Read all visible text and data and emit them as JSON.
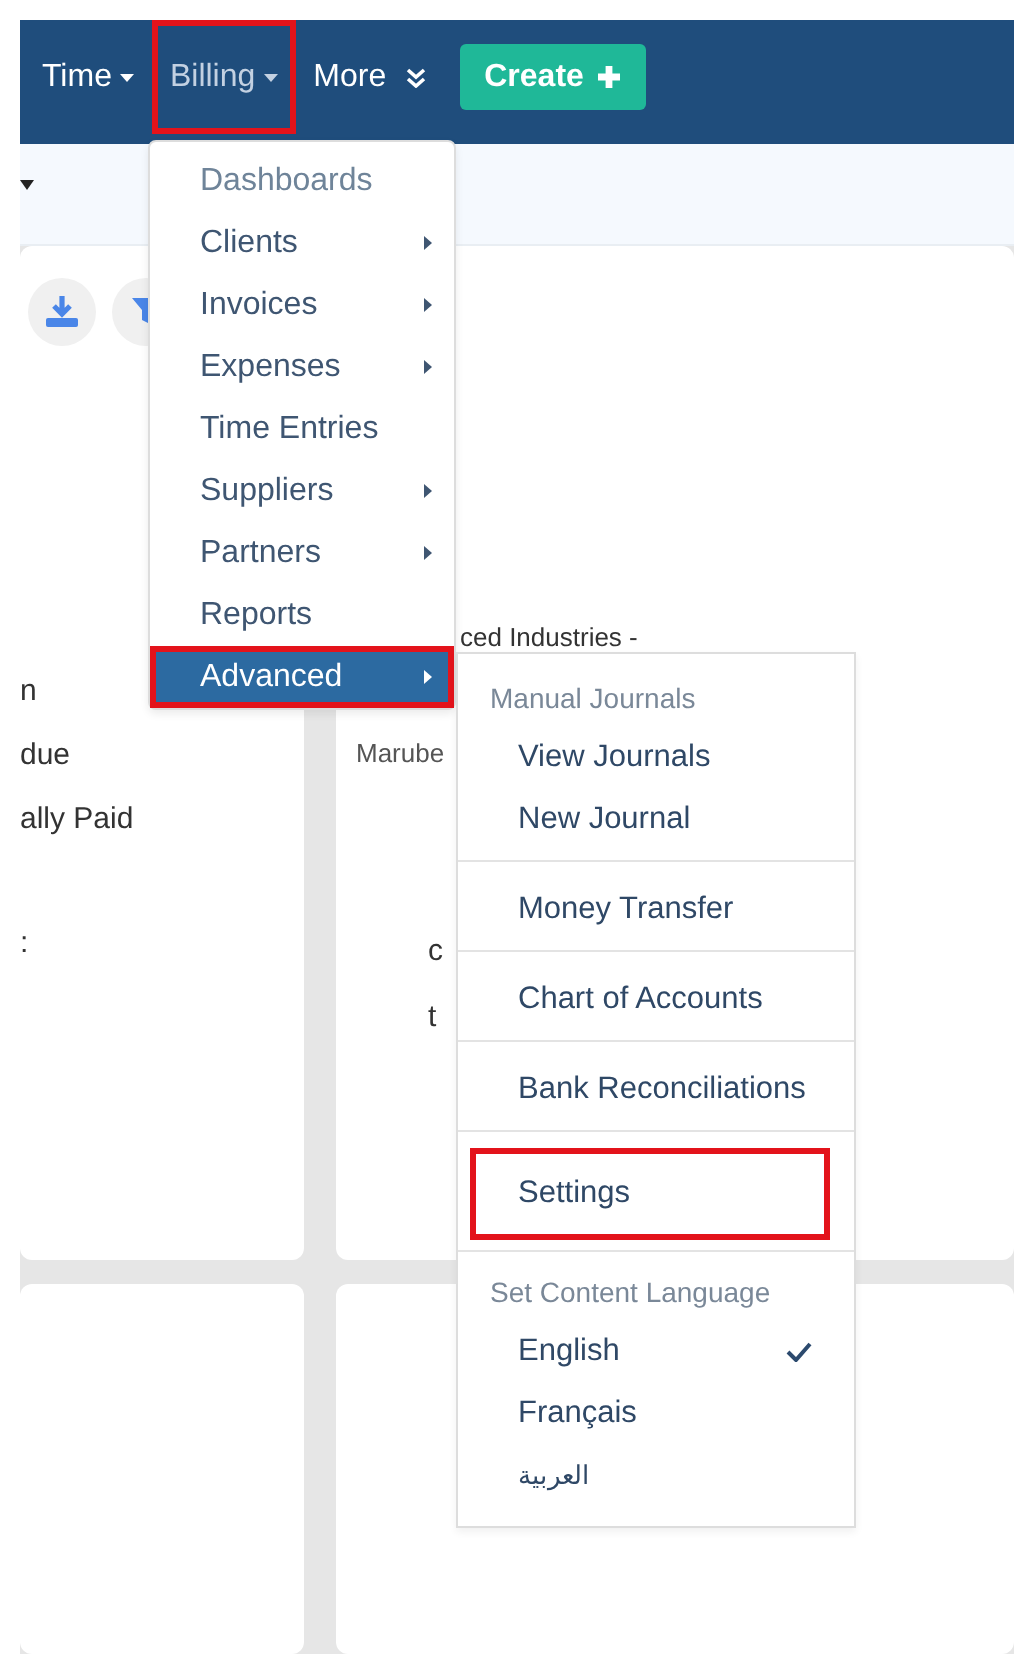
{
  "nav": {
    "items": [
      {
        "label": "Time",
        "kind": "dropdown",
        "selected": false,
        "highlighted": false
      },
      {
        "label": "Billing",
        "kind": "dropdown",
        "selected": true,
        "highlighted": true
      },
      {
        "label": "More",
        "kind": "more",
        "selected": false,
        "highlighted": false
      }
    ],
    "create_button": {
      "label": "Create"
    }
  },
  "page": {
    "left_texts": [
      "n",
      "due",
      "ally Paid",
      ":"
    ],
    "right_texts": [
      "ced Industries -",
      "Marube",
      "c",
      "t"
    ]
  },
  "billing_menu": [
    {
      "label": "Dashboards",
      "kind": "muted",
      "submenu": false,
      "selected": false,
      "highlighted": false
    },
    {
      "label": "Clients",
      "kind": "item",
      "submenu": true,
      "selected": false,
      "highlighted": false
    },
    {
      "label": "Invoices",
      "kind": "item",
      "submenu": true,
      "selected": false,
      "highlighted": false
    },
    {
      "label": "Expenses",
      "kind": "item",
      "submenu": true,
      "selected": false,
      "highlighted": false
    },
    {
      "label": "Time Entries",
      "kind": "item",
      "submenu": false,
      "selected": false,
      "highlighted": false
    },
    {
      "label": "Suppliers",
      "kind": "item",
      "submenu": true,
      "selected": false,
      "highlighted": false
    },
    {
      "label": "Partners",
      "kind": "item",
      "submenu": true,
      "selected": false,
      "highlighted": false
    },
    {
      "label": "Reports",
      "kind": "item",
      "submenu": false,
      "selected": false,
      "highlighted": false
    },
    {
      "label": "Advanced",
      "kind": "item",
      "submenu": true,
      "selected": true,
      "highlighted": true
    }
  ],
  "advanced_menu": [
    {
      "kind": "header",
      "label": "Manual Journals"
    },
    {
      "kind": "item",
      "label": "View Journals",
      "highlighted": false,
      "checked": false
    },
    {
      "kind": "item",
      "label": "New Journal",
      "highlighted": false,
      "checked": false
    },
    {
      "kind": "divider"
    },
    {
      "kind": "item",
      "label": "Money Transfer",
      "highlighted": false,
      "checked": false
    },
    {
      "kind": "divider"
    },
    {
      "kind": "item",
      "label": "Chart of Accounts",
      "highlighted": false,
      "checked": false
    },
    {
      "kind": "divider"
    },
    {
      "kind": "item",
      "label": "Bank Reconciliations",
      "highlighted": false,
      "checked": false
    },
    {
      "kind": "divider"
    },
    {
      "kind": "item",
      "label": "Settings",
      "highlighted": true,
      "checked": false
    },
    {
      "kind": "divider"
    },
    {
      "kind": "header",
      "label": "Set Content Language"
    },
    {
      "kind": "item",
      "label": "English",
      "highlighted": false,
      "checked": true
    },
    {
      "kind": "item",
      "label": "Français",
      "highlighted": false,
      "checked": false
    },
    {
      "kind": "small",
      "label": "العربية",
      "highlighted": false,
      "checked": false
    }
  ]
}
